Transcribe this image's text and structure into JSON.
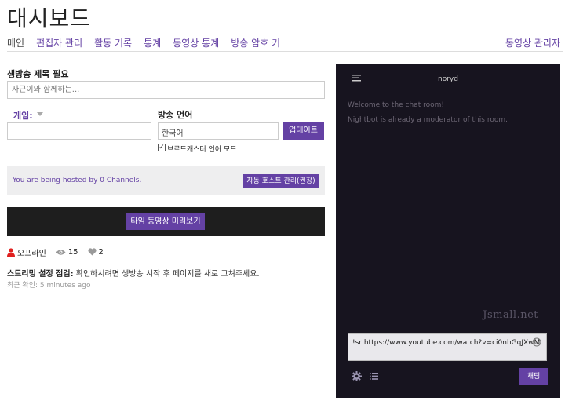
{
  "page": {
    "title": "대시보드"
  },
  "tabs": [
    {
      "label": "메인",
      "active": true
    },
    {
      "label": "편집자 관리"
    },
    {
      "label": "활동 기록"
    },
    {
      "label": "통계"
    },
    {
      "label": "동영상 통계"
    },
    {
      "label": "방송 암호 키"
    }
  ],
  "tabs_right": {
    "label": "동영상 관리자"
  },
  "stream_form": {
    "title_label": "생방송 제목 필요",
    "title_placeholder": "자근이와 함께하는...",
    "game_label": "게임:",
    "game_value": "",
    "language_label": "방송 언어",
    "language_value": "한국어",
    "update_button": "업데이트",
    "broadcaster_language_checked": true,
    "broadcaster_language_label": "브로드캐스터 언어 모드"
  },
  "hosting": {
    "text": "You are being hosted by 0 Channels.",
    "button": "자동 호스트 관리(권장)"
  },
  "preview": {
    "button": "타임 동영상 미리보기"
  },
  "stats": {
    "status": "오프라인",
    "viewers": "15",
    "followers": "2"
  },
  "stream_notice": {
    "prefix": "스트리밍 설정 점검:",
    "text": " 확인하시려면 생방송 시작 후 페이지를 새로 고쳐주세요.",
    "last_checked": "최근 확인: 5 minutes ago"
  },
  "chat": {
    "username": "noryd",
    "messages": [
      "Welcome to the chat room!",
      "Nightbot is already a moderator of this room."
    ],
    "watermark": "Jsmall.net",
    "input_value": "!sr https://www.youtube.com/watch?v=ci0nhGqJXwM",
    "send_button": "채팅"
  },
  "colors": {
    "accent": "#6441a4",
    "chat_bg": "#17141f",
    "offline_red": "#e0201f"
  },
  "icons": [
    "menu-icon",
    "caret-down-icon",
    "person-icon",
    "eye-icon",
    "heart-icon",
    "emoji-icon",
    "gear-icon",
    "list-icon"
  ]
}
